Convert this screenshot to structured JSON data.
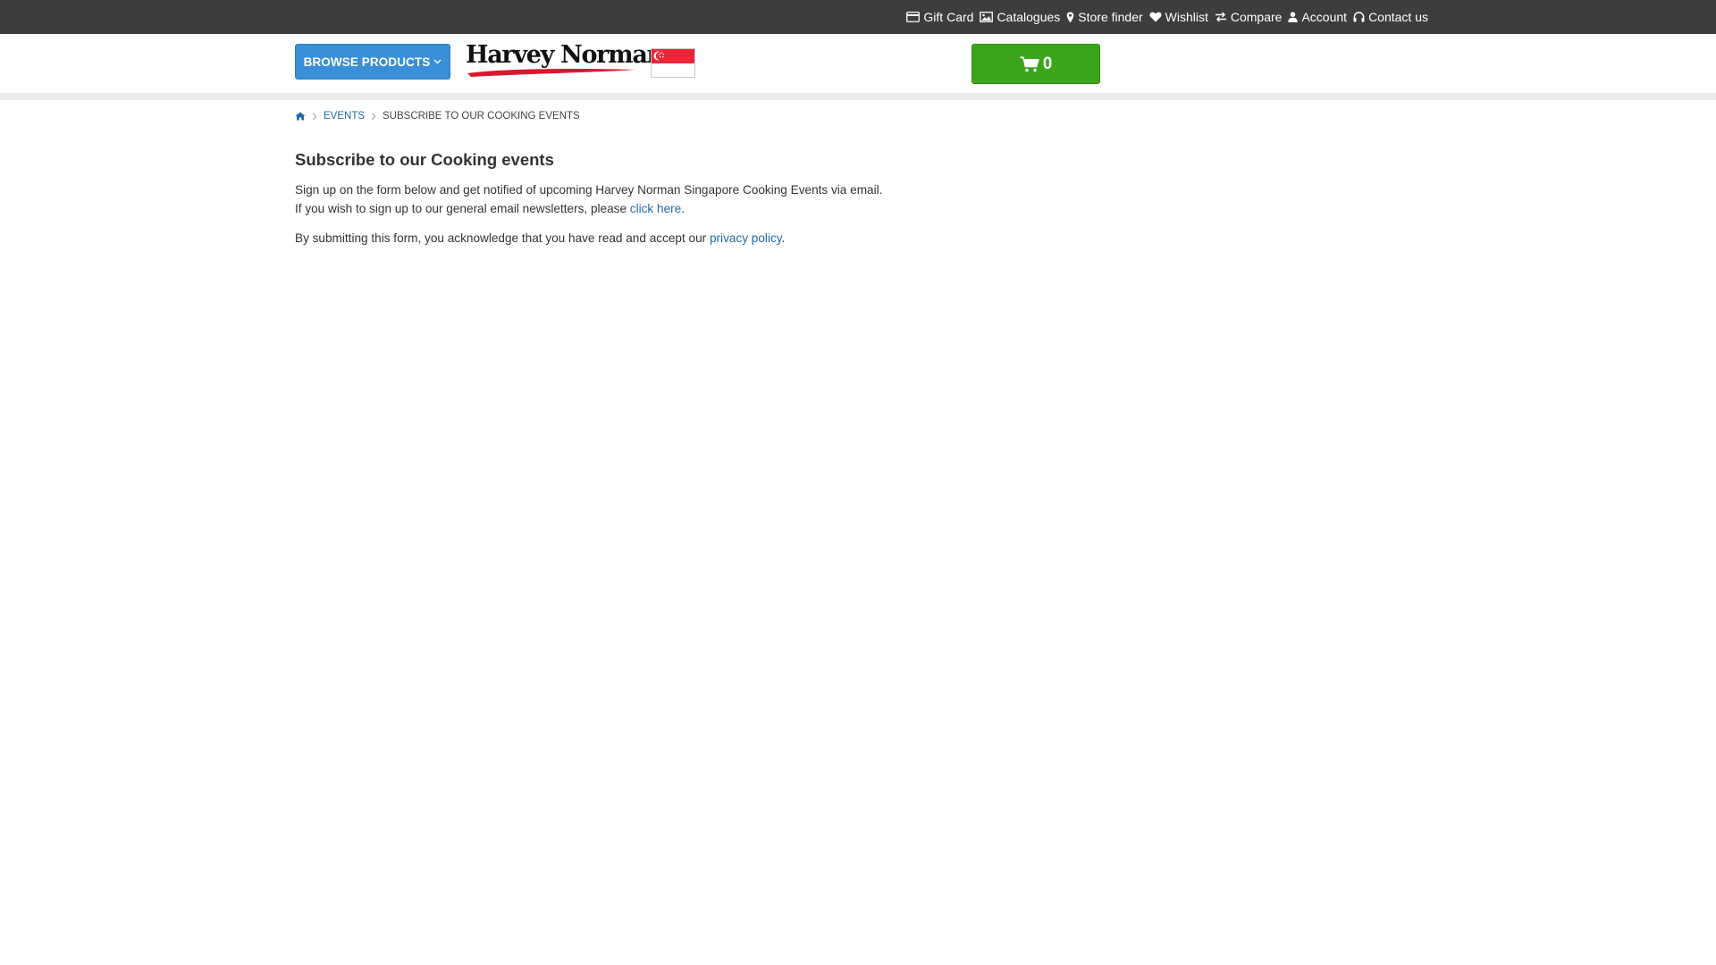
{
  "topbar": {
    "links": [
      {
        "label": "Gift Card",
        "icon": "credit-card-icon"
      },
      {
        "label": "Catalogues",
        "icon": "image-icon"
      },
      {
        "label": "Store finder",
        "icon": "map-marker-icon"
      },
      {
        "label": "Wishlist",
        "icon": "heart-icon"
      },
      {
        "label": "Compare",
        "icon": "exchange-icon"
      },
      {
        "label": "Account",
        "icon": "user-icon"
      },
      {
        "label": "Contact us",
        "icon": "headphones-icon"
      }
    ]
  },
  "header": {
    "browse_label": "BROWSE PRODUCTS",
    "logo_text": "Harvey Norman",
    "cart_count": "0",
    "colors": {
      "topbar": "#3d3d3d",
      "browse": "#3a8fd6",
      "cart": "#3aa51b",
      "link": "#1f6aa5",
      "flag_red": "#ee2536"
    }
  },
  "breadcrumb": {
    "home_icon": "home-icon",
    "items": [
      {
        "label": "EVENTS"
      }
    ],
    "current": "SUBSCRIBE TO OUR COOKING EVENTS"
  },
  "main": {
    "title": "Subscribe to our Cooking events",
    "para1": "Sign up on the form below and get notified of upcoming Harvey Norman Singapore Cooking Events via email.",
    "para2_prefix": "If you wish to sign up to our general email newsletters, please ",
    "para2_link": "click here",
    "para2_suffix": ".",
    "para3_prefix": "By submitting this form, you acknowledge that you have read and accept our ",
    "para3_link": "privacy policy",
    "para3_suffix": "."
  }
}
